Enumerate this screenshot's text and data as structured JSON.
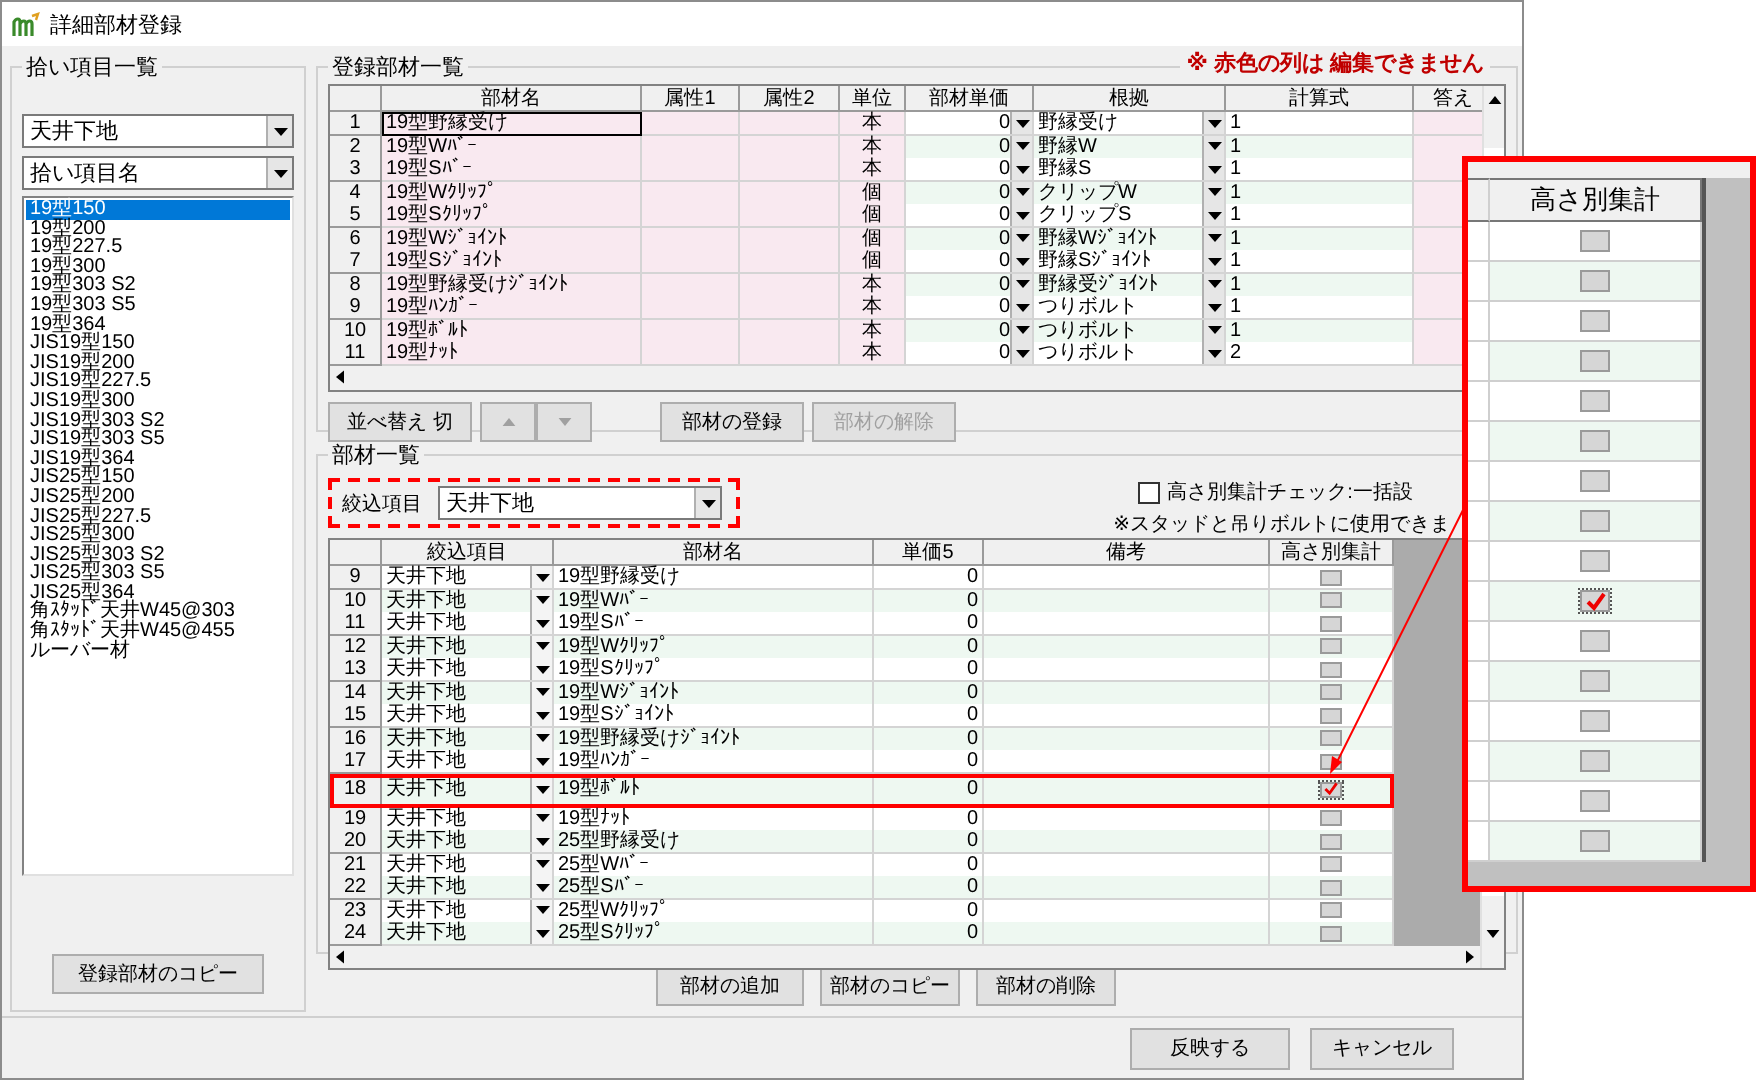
{
  "window": {
    "title": "詳細部材登録"
  },
  "pickup_panel": {
    "title": "拾い項目一覧",
    "category": "天井下地",
    "column": "拾い項目名",
    "copy_button": "登録部材のコピー",
    "items": [
      {
        "label": "19型150",
        "selected": true
      },
      {
        "label": "19型200",
        "selected": false
      },
      {
        "label": "19型227.5",
        "selected": false
      },
      {
        "label": "19型300",
        "selected": false
      },
      {
        "label": "19型303 S2",
        "selected": false
      },
      {
        "label": "19型303 S5",
        "selected": false
      },
      {
        "label": "19型364",
        "selected": false
      },
      {
        "label": "JIS19型150",
        "selected": false
      },
      {
        "label": "JIS19型200",
        "selected": false
      },
      {
        "label": "JIS19型227.5",
        "selected": false
      },
      {
        "label": "JIS19型300",
        "selected": false
      },
      {
        "label": "JIS19型303 S2",
        "selected": false
      },
      {
        "label": "JIS19型303 S5",
        "selected": false
      },
      {
        "label": "JIS19型364",
        "selected": false
      },
      {
        "label": "JIS25型150",
        "selected": false
      },
      {
        "label": "JIS25型200",
        "selected": false
      },
      {
        "label": "JIS25型227.5",
        "selected": false
      },
      {
        "label": "JIS25型300",
        "selected": false
      },
      {
        "label": "JIS25型303 S2",
        "selected": false
      },
      {
        "label": "JIS25型303 S5",
        "selected": false
      },
      {
        "label": "JIS25型364",
        "selected": false
      },
      {
        "label": "角ｽﾀｯﾄﾞ天井W45@303",
        "selected": false
      },
      {
        "label": "角ｽﾀｯﾄﾞ天井W45@455",
        "selected": false
      },
      {
        "label": "ルーバー材",
        "selected": false
      }
    ]
  },
  "registered_parts": {
    "title": "登録部材一覧",
    "notice": "※ 赤色の列は 編集できません",
    "columns": [
      "部材名",
      "属性1",
      "属性2",
      "単位",
      "部材単価",
      "根拠",
      "計算式",
      "答え"
    ],
    "rows": [
      {
        "no": "1",
        "name": "19型野縁受け",
        "unit": "本",
        "price": "0",
        "basis": "野縁受け",
        "formula": "1",
        "selected": true
      },
      {
        "no": "2",
        "name": "19型Wﾊﾞｰ",
        "unit": "本",
        "price": "0",
        "basis": "野縁W",
        "formula": "1",
        "selected": false
      },
      {
        "no": "3",
        "name": "19型Sﾊﾞｰ",
        "unit": "本",
        "price": "0",
        "basis": "野縁S",
        "formula": "1",
        "selected": false
      },
      {
        "no": "4",
        "name": "19型Wｸﾘｯﾌﾟ",
        "unit": "個",
        "price": "0",
        "basis": "クリップW",
        "formula": "1",
        "selected": false
      },
      {
        "no": "5",
        "name": "19型Sｸﾘｯﾌﾟ",
        "unit": "個",
        "price": "0",
        "basis": "クリップS",
        "formula": "1",
        "selected": false
      },
      {
        "no": "6",
        "name": "19型Wｼﾞｮｲﾝﾄ",
        "unit": "個",
        "price": "0",
        "basis": "野縁Wｼﾞｮｲﾝﾄ",
        "formula": "1",
        "selected": false
      },
      {
        "no": "7",
        "name": "19型Sｼﾞｮｲﾝﾄ",
        "unit": "個",
        "price": "0",
        "basis": "野縁Sｼﾞｮｲﾝﾄ",
        "formula": "1",
        "selected": false
      },
      {
        "no": "8",
        "name": "19型野縁受けｼﾞｮｲﾝﾄ",
        "unit": "本",
        "price": "0",
        "basis": "野縁受ｼﾞｮｲﾝﾄ",
        "formula": "1",
        "selected": false
      },
      {
        "no": "9",
        "name": "19型ﾊﾝｶﾞｰ",
        "unit": "本",
        "price": "0",
        "basis": "つりボルト",
        "formula": "1",
        "selected": false
      },
      {
        "no": "10",
        "name": "19型ﾎﾞﾙﾄ",
        "unit": "本",
        "price": "0",
        "basis": "つりボルト",
        "formula": "1",
        "selected": false
      },
      {
        "no": "11",
        "name": "19型ﾅｯﾄ",
        "unit": "本",
        "price": "0",
        "basis": "つりボルト",
        "formula": "2",
        "selected": false
      }
    ],
    "buttons": [
      {
        "kind": "text",
        "label": "並べ替え 切",
        "disabled": false
      },
      {
        "kind": "up",
        "disabled": true
      },
      {
        "kind": "down",
        "disabled": true
      },
      {
        "kind": "text",
        "label": "部材の登録",
        "disabled": false
      },
      {
        "kind": "text",
        "label": "部材の解除",
        "disabled": true
      }
    ]
  },
  "parts_list": {
    "title": "部材一覧",
    "filter_label": "絞込項目",
    "filter_value": "天井下地",
    "bulk_check_label": "高さ別集計チェック:一括設",
    "bulk_checked": false,
    "note": "※スタッドと吊りボルトに使用できま",
    "columns": [
      "絞込項目",
      "部材名",
      "単価5",
      "備考",
      "高さ別集計"
    ],
    "rows": [
      {
        "no": "9",
        "category": "天井下地",
        "name": "19型野縁受け",
        "price": "0",
        "checked": false,
        "highlighted": false
      },
      {
        "no": "10",
        "category": "天井下地",
        "name": "19型Wﾊﾞｰ",
        "price": "0",
        "checked": false,
        "highlighted": false
      },
      {
        "no": "11",
        "category": "天井下地",
        "name": "19型Sﾊﾞｰ",
        "price": "0",
        "checked": false,
        "highlighted": false
      },
      {
        "no": "12",
        "category": "天井下地",
        "name": "19型Wｸﾘｯﾌﾟ",
        "price": "0",
        "checked": false,
        "highlighted": false
      },
      {
        "no": "13",
        "category": "天井下地",
        "name": "19型Sｸﾘｯﾌﾟ",
        "price": "0",
        "checked": false,
        "highlighted": false
      },
      {
        "no": "14",
        "category": "天井下地",
        "name": "19型Wｼﾞｮｲﾝﾄ",
        "price": "0",
        "checked": false,
        "highlighted": false
      },
      {
        "no": "15",
        "category": "天井下地",
        "name": "19型Sｼﾞｮｲﾝﾄ",
        "price": "0",
        "checked": false,
        "highlighted": false
      },
      {
        "no": "16",
        "category": "天井下地",
        "name": "19型野縁受けｼﾞｮｲﾝﾄ",
        "price": "0",
        "checked": false,
        "highlighted": false
      },
      {
        "no": "17",
        "category": "天井下地",
        "name": "19型ﾊﾝｶﾞｰ",
        "price": "0",
        "checked": false,
        "highlighted": false
      },
      {
        "no": "18",
        "category": "天井下地",
        "name": "19型ﾎﾞﾙﾄ",
        "price": "0",
        "checked": true,
        "highlighted": true
      },
      {
        "no": "19",
        "category": "天井下地",
        "name": "19型ﾅｯﾄ",
        "price": "0",
        "checked": false,
        "highlighted": false
      },
      {
        "no": "20",
        "category": "天井下地",
        "name": "25型野縁受け",
        "price": "0",
        "checked": false,
        "highlighted": false
      },
      {
        "no": "21",
        "category": "天井下地",
        "name": "25型Wﾊﾞｰ",
        "price": "0",
        "checked": false,
        "highlighted": false
      },
      {
        "no": "22",
        "category": "天井下地",
        "name": "25型Sﾊﾞｰ",
        "price": "0",
        "checked": false,
        "highlighted": false
      },
      {
        "no": "23",
        "category": "天井下地",
        "name": "25型Wｸﾘｯﾌﾟ",
        "price": "0",
        "checked": false,
        "highlighted": false
      },
      {
        "no": "24",
        "category": "天井下地",
        "name": "25型Sｸﾘｯﾌﾟ",
        "price": "0",
        "checked": false,
        "highlighted": false
      }
    ],
    "buttons": [
      "部材の追加",
      "部材のコピー",
      "部材の削除"
    ]
  },
  "footer_buttons": [
    "反映する",
    "キャンセル"
  ],
  "callout": {
    "header": "高さ別集計"
  }
}
